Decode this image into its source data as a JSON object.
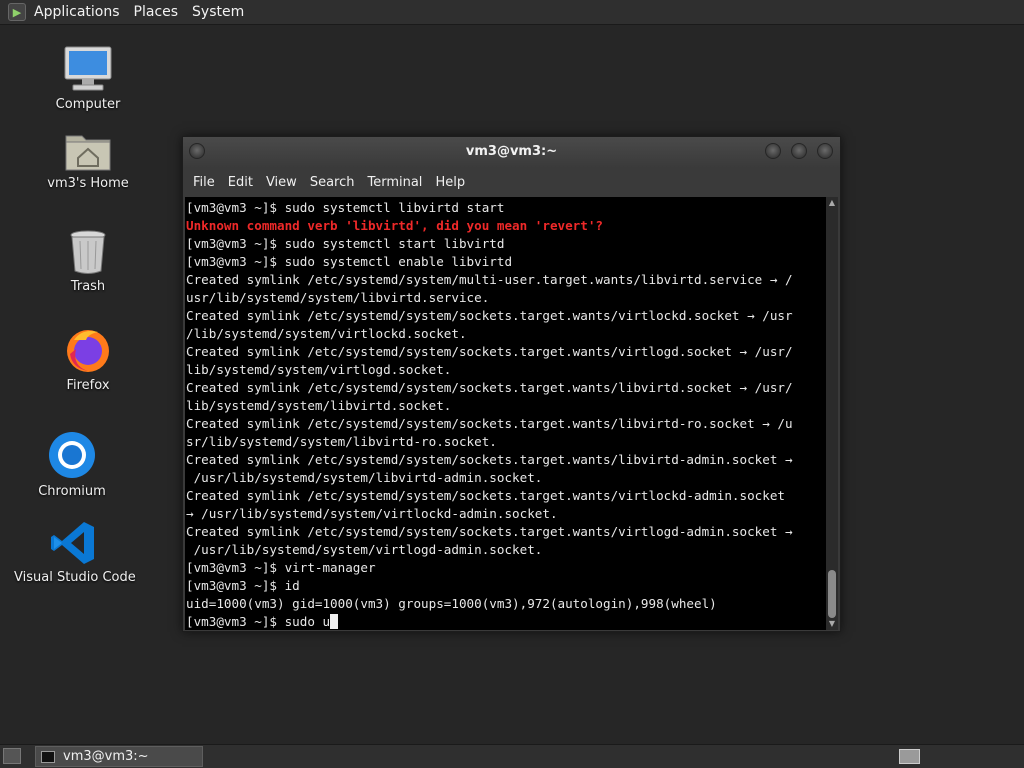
{
  "top_panel": {
    "menus": [
      "Applications",
      "Places",
      "System"
    ]
  },
  "desktop": {
    "icons": [
      {
        "label": "Computer",
        "icon": "computer-icon"
      },
      {
        "label": "vm3's Home",
        "icon": "home-folder-icon"
      },
      {
        "label": "Trash",
        "icon": "trash-icon"
      },
      {
        "label": "Firefox",
        "icon": "firefox-icon"
      },
      {
        "label": "Chromium",
        "icon": "chromium-icon"
      },
      {
        "label": "Visual Studio Code",
        "icon": "vscode-icon"
      }
    ]
  },
  "terminal": {
    "title": "vm3@vm3:~",
    "menu": [
      "File",
      "Edit",
      "View",
      "Search",
      "Terminal",
      "Help"
    ],
    "lines": [
      {
        "text": "[vm3@vm3 ~]$ sudo systemctl libvirtd start",
        "style": "normal"
      },
      {
        "text": "Unknown command verb 'libvirtd', did you mean 'revert'?",
        "style": "error"
      },
      {
        "text": "[vm3@vm3 ~]$ sudo systemctl start libvirtd",
        "style": "normal"
      },
      {
        "text": "[vm3@vm3 ~]$ sudo systemctl enable libvirtd",
        "style": "normal"
      },
      {
        "text": "Created symlink /etc/systemd/system/multi-user.target.wants/libvirtd.service → /",
        "style": "normal"
      },
      {
        "text": "usr/lib/systemd/system/libvirtd.service.",
        "style": "normal"
      },
      {
        "text": "Created symlink /etc/systemd/system/sockets.target.wants/virtlockd.socket → /usr",
        "style": "normal"
      },
      {
        "text": "/lib/systemd/system/virtlockd.socket.",
        "style": "normal"
      },
      {
        "text": "Created symlink /etc/systemd/system/sockets.target.wants/virtlogd.socket → /usr/",
        "style": "normal"
      },
      {
        "text": "lib/systemd/system/virtlogd.socket.",
        "style": "normal"
      },
      {
        "text": "Created symlink /etc/systemd/system/sockets.target.wants/libvirtd.socket → /usr/",
        "style": "normal"
      },
      {
        "text": "lib/systemd/system/libvirtd.socket.",
        "style": "normal"
      },
      {
        "text": "Created symlink /etc/systemd/system/sockets.target.wants/libvirtd-ro.socket → /u",
        "style": "normal"
      },
      {
        "text": "sr/lib/systemd/system/libvirtd-ro.socket.",
        "style": "normal"
      },
      {
        "text": "Created symlink /etc/systemd/system/sockets.target.wants/libvirtd-admin.socket →",
        "style": "normal"
      },
      {
        "text": " /usr/lib/systemd/system/libvirtd-admin.socket.",
        "style": "normal"
      },
      {
        "text": "Created symlink /etc/systemd/system/sockets.target.wants/virtlockd-admin.socket",
        "style": "normal"
      },
      {
        "text": "→ /usr/lib/systemd/system/virtlockd-admin.socket.",
        "style": "normal"
      },
      {
        "text": "Created symlink /etc/systemd/system/sockets.target.wants/virtlogd-admin.socket →",
        "style": "normal"
      },
      {
        "text": " /usr/lib/systemd/system/virtlogd-admin.socket.",
        "style": "normal"
      },
      {
        "text": "[vm3@vm3 ~]$ virt-manager",
        "style": "normal"
      },
      {
        "text": "[vm3@vm3 ~]$ id",
        "style": "normal"
      },
      {
        "text": "uid=1000(vm3) gid=1000(vm3) groups=1000(vm3),972(autologin),998(wheel)",
        "style": "normal"
      },
      {
        "text": "[vm3@vm3 ~]$ sudo u",
        "style": "prompt"
      }
    ],
    "colors": {
      "error": "#ef2929",
      "background": "#000000",
      "foreground": "#e8e8e8"
    }
  },
  "bottom_panel": {
    "task_title": "vm3@vm3:~"
  }
}
